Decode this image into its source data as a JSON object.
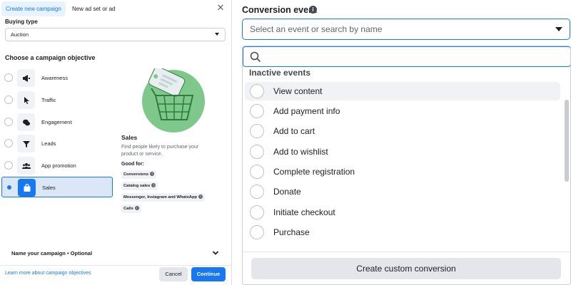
{
  "left_panel": {
    "tabs": [
      {
        "label": "Create new campaign",
        "active": true
      },
      {
        "label": "New ad set or ad",
        "active": false
      }
    ],
    "close_icon": "close-icon",
    "buying_type": {
      "label": "Buying type",
      "value": "Auction"
    },
    "objective_heading": "Choose a campaign objective",
    "objectives": [
      {
        "label": "Awareness",
        "icon": "megaphone-icon",
        "selected": false
      },
      {
        "label": "Traffic",
        "icon": "cursor-icon",
        "selected": false
      },
      {
        "label": "Engagement",
        "icon": "chat-icon",
        "selected": false
      },
      {
        "label": "Leads",
        "icon": "funnel-icon",
        "selected": false
      },
      {
        "label": "App promotion",
        "icon": "people-icon",
        "selected": false
      },
      {
        "label": "Sales",
        "icon": "shopping-bag-icon",
        "selected": true
      }
    ],
    "detail": {
      "title": "Sales",
      "description": "Find people likely to purchase your product or service.",
      "good_for_label": "Good for:",
      "good_for": [
        "Conversions",
        "Catalog sales",
        "Messenger, Instagram and WhatsApp",
        "Calls"
      ]
    },
    "name_campaign": "Name your campaign • Optional",
    "learn_more": "Learn more about campaign objectives",
    "cancel": "Cancel",
    "continue": "Continue",
    "colors": {
      "accent": "#1877f2",
      "illustration": "#7fc88c",
      "illustration_dark": "#2e7d3c"
    }
  },
  "right_panel": {
    "label": "Conversion event",
    "select_placeholder": "Select an event or search by name",
    "search_value": "",
    "section_header": "Inactive events",
    "events": [
      "View content",
      "Add payment info",
      "Add to cart",
      "Add to wishlist",
      "Complete registration",
      "Donate",
      "Initiate checkout",
      "Purchase"
    ],
    "hovered_event_index": 0,
    "custom_button": "Create custom conversion"
  }
}
